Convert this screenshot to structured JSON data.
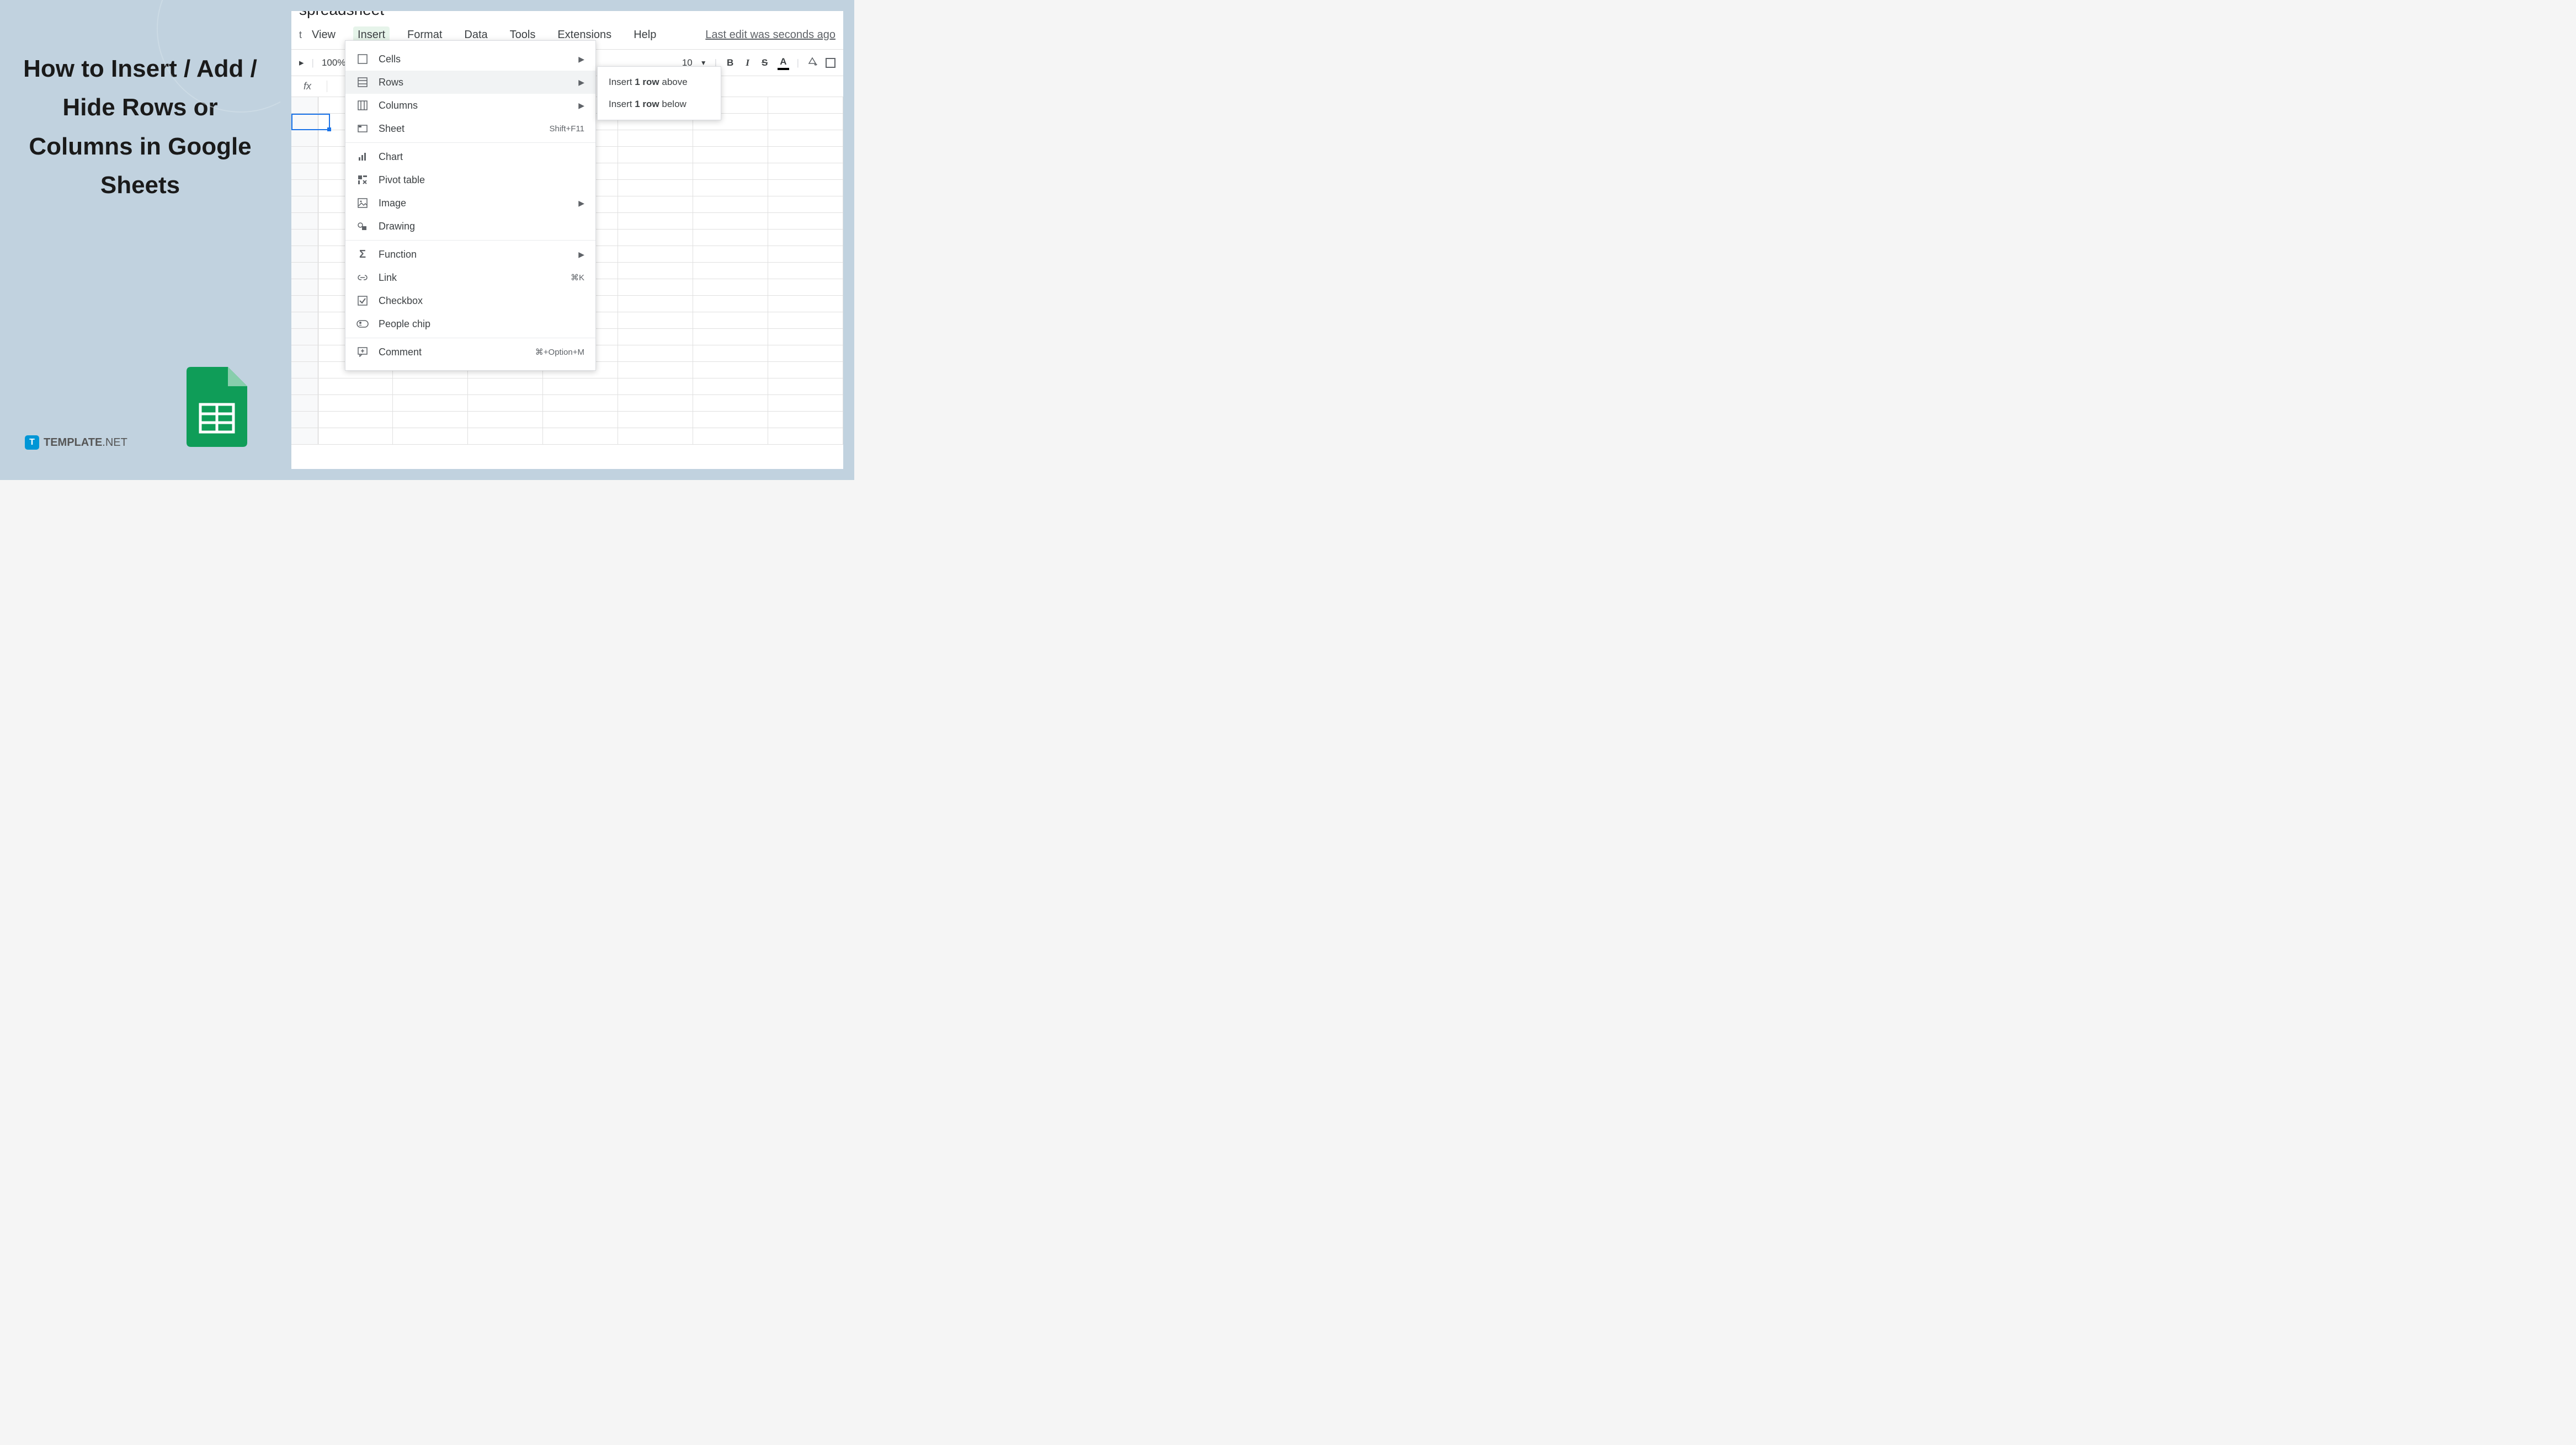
{
  "title": "How to Insert / Add / Hide Rows or Columns in Google Sheets",
  "logo": {
    "letter": "T",
    "text": "TEMPLATE",
    "suffix": ".NET"
  },
  "app": {
    "doc_title": "spreadsheet",
    "menu": [
      "View",
      "Insert",
      "Format",
      "Data",
      "Tools",
      "Extensions",
      "Help"
    ],
    "active_menu_index": 1,
    "last_edit": "Last edit was seconds ago",
    "zoom": "100%",
    "font_size": "10",
    "fx": "fx"
  },
  "insert_menu": [
    {
      "section": [
        {
          "icon": "cells",
          "label": "Cells",
          "arrow": true
        },
        {
          "icon": "rows",
          "label": "Rows",
          "arrow": true,
          "highlighted": true
        },
        {
          "icon": "columns",
          "label": "Columns",
          "arrow": true
        },
        {
          "icon": "sheet",
          "label": "Sheet",
          "shortcut": "Shift+F11"
        }
      ]
    },
    {
      "section": [
        {
          "icon": "chart",
          "label": "Chart"
        },
        {
          "icon": "pivot",
          "label": "Pivot table"
        },
        {
          "icon": "image",
          "label": "Image",
          "arrow": true
        },
        {
          "icon": "drawing",
          "label": "Drawing"
        }
      ]
    },
    {
      "section": [
        {
          "icon": "function",
          "label": "Function",
          "arrow": true
        },
        {
          "icon": "link",
          "label": "Link",
          "shortcut": "⌘K"
        },
        {
          "icon": "checkbox",
          "label": "Checkbox"
        },
        {
          "icon": "people",
          "label": "People chip"
        }
      ]
    },
    {
      "section": [
        {
          "icon": "comment",
          "label": "Comment",
          "shortcut": "⌘+Option+M"
        }
      ]
    }
  ],
  "submenu": {
    "row_above_pre": "Insert ",
    "row_above_bold": "1 row",
    "row_above_post": " above",
    "row_below_pre": "Insert ",
    "row_below_bold": "1 row",
    "row_below_post": " below"
  }
}
